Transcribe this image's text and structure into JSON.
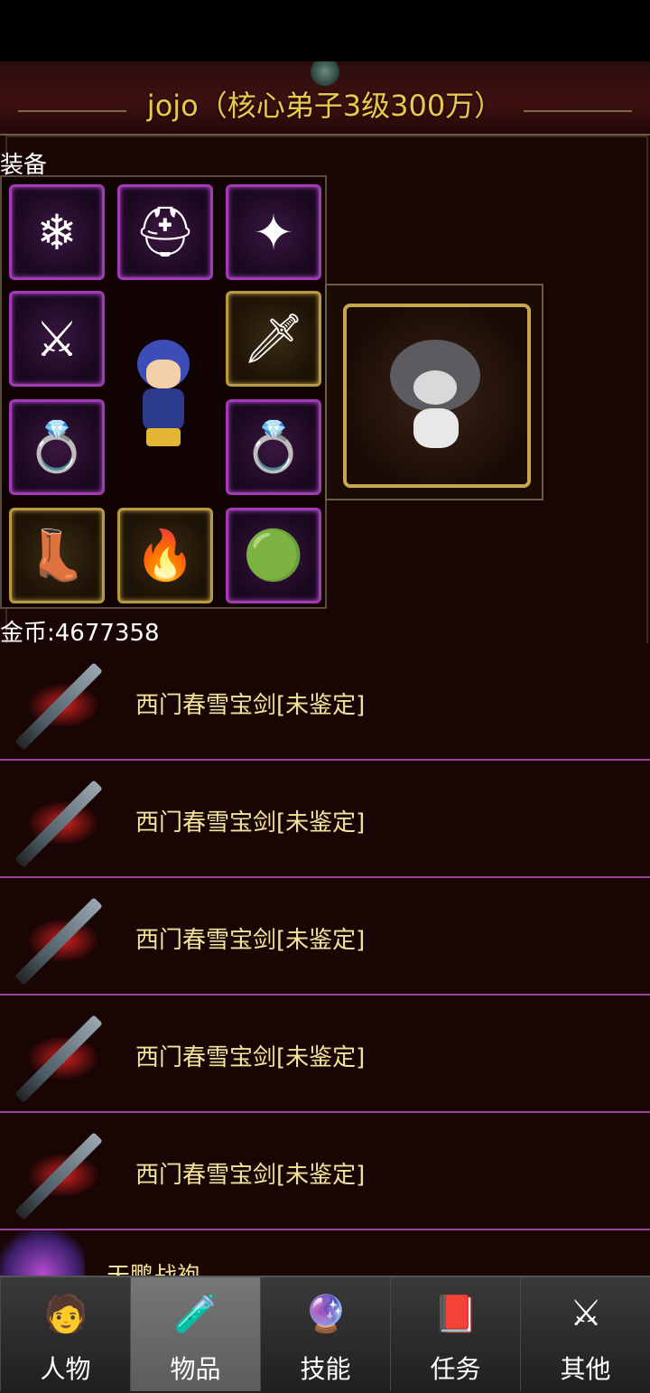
{
  "title": "jojo（核心弟子3级300万）",
  "equipment_label": "装备",
  "gold": {
    "text": "金币:4677358"
  },
  "items": [
    {
      "name": "西门春雪宝剑[未鉴定]"
    },
    {
      "name": "西门春雪宝剑[未鉴定]"
    },
    {
      "name": "西门春雪宝剑[未鉴定]"
    },
    {
      "name": "西门春雪宝剑[未鉴定]"
    },
    {
      "name": "西门春雪宝剑[未鉴定]"
    }
  ],
  "partial_item": {
    "name": "天鹏战袍"
  },
  "tabs": [
    {
      "label": "人物",
      "icon": "character-icon"
    },
    {
      "label": "物品",
      "icon": "potion-icon",
      "active": true
    },
    {
      "label": "技能",
      "icon": "skill-orb-icon"
    },
    {
      "label": "任务",
      "icon": "quest-book-icon"
    },
    {
      "label": "其他",
      "icon": "misc-swords-icon"
    }
  ],
  "colors": {
    "accent_gold": "#e9c84c",
    "item_text": "#f2e39b",
    "divider": "#9b3fa0",
    "slot_purple": "#a23ab7"
  }
}
